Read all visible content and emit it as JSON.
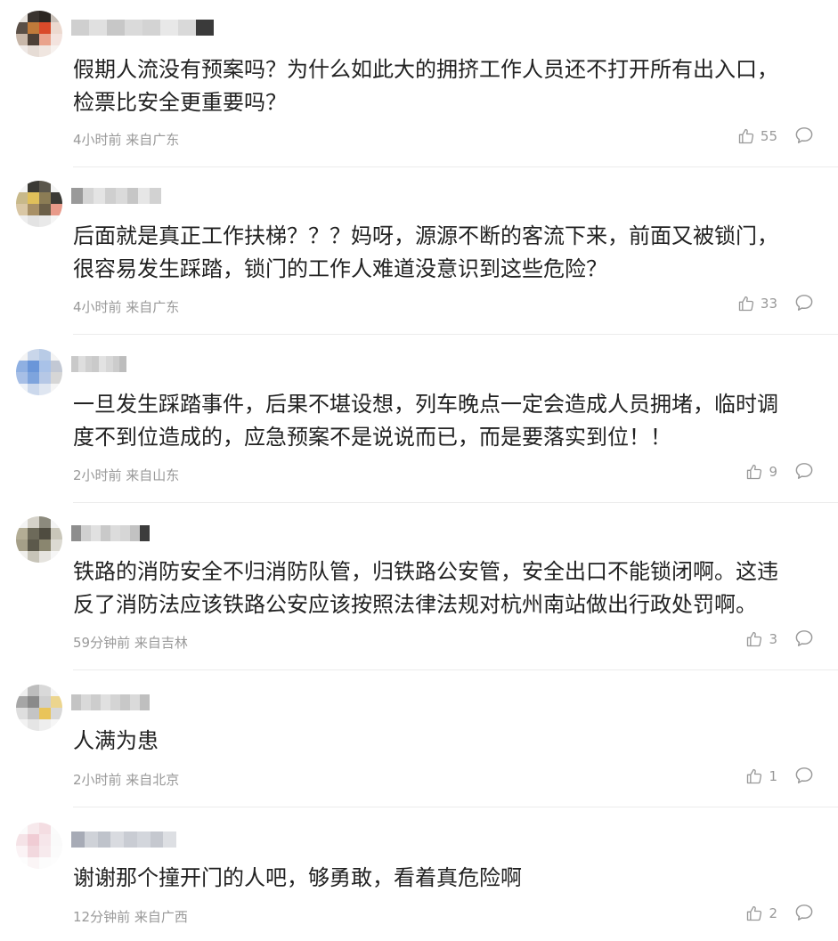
{
  "comments": [
    {
      "text_lines": [
        "假期人流没有预案吗？为什么如此大的拥挤工作人员还不打开所有出入口，",
        "检票比安全更重要吗？"
      ],
      "meta": "4小时前 来自广东",
      "likes": "55",
      "avatar_colors": [
        "#e9e4df",
        "#3a3430",
        "#2b2622",
        "#c9c0b8",
        "#5a4f46",
        "#c07a3a",
        "#d94a2a",
        "#ecd9cf",
        "#c8b7a9",
        "#4d4036",
        "#e9a38c",
        "#f3e3de",
        "#efe9e6",
        "#e6dcd5",
        "#f0e6e0",
        "#f7f2ef"
      ],
      "name_colors": [
        "#cfcfcf",
        "#e0e0e0",
        "#c7c7c7",
        "#dadada",
        "#d3d3d3",
        "#e8e8e8",
        "#d9d9d9",
        "#3a3a3a"
      ]
    },
    {
      "text_lines": [
        "后面就是真正工作扶梯？？？妈呀，源源不断的客流下来，前面又被锁门，",
        "很容易发生踩踏，锁门的工作人难道没意识到这些危险？"
      ],
      "meta": "4小时前 来自广东",
      "likes": "33",
      "avatar_colors": [
        "#f5f5f5",
        "#3b3a35",
        "#5a564c",
        "#f4f4f4",
        "#c8b98a",
        "#e0c05a",
        "#8b7c55",
        "#3b3a35",
        "#d9c7a5",
        "#a89066",
        "#6b5f48",
        "#e89a8a",
        "#eeeeee",
        "#e3e3e3",
        "#e9e9e9",
        "#f5f5f5"
      ],
      "name_colors": [
        "#9a9a9a",
        "#d5d5d5",
        "#e4e4e4",
        "#cfcfcf",
        "#dadada",
        "#c6c6c6",
        "#e6e6e6",
        "#d2d2d2"
      ]
    },
    {
      "text_lines": [
        "一旦发生踩踏事件，后果不堪设想，列车晚点一定会造成人员拥堵，临时调",
        "度不到位造成的，应急预案不是说说而已，而是要落实到位！！"
      ],
      "meta": "2小时前 来自山东",
      "likes": "9",
      "avatar_colors": [
        "#f4f4f4",
        "#c9d6ea",
        "#b8cbe6",
        "#f4f4f4",
        "#8fb0e2",
        "#6a96d9",
        "#a9c2e8",
        "#c2c8d4",
        "#a7bfe6",
        "#7ea4dd",
        "#b6c8e6",
        "#d6d6d6",
        "#eef2f8",
        "#cbd8ec",
        "#dfe6f1",
        "#f5f5f5"
      ],
      "name_colors": [
        "#c9c9c9",
        "#dedede",
        "#d0d0d0",
        "#cacaca",
        "#e2e2e2",
        "#d7d7d7",
        "#cccccc",
        "#bdbdbd"
      ]
    },
    {
      "text_lines": [
        "铁路的消防安全不归消防队管，归铁路公安管，安全出口不能锁闭啊。这违",
        "反了消防法应该铁路公安应该按照法律法规对杭州南站做出行政处罚啊。"
      ],
      "meta": "59分钟前 来自吉林",
      "likes": "3",
      "avatar_colors": [
        "#f4f4f4",
        "#d5d2c9",
        "#8c8a7d",
        "#f4f4f4",
        "#b3ad95",
        "#6d6a5a",
        "#4f4c40",
        "#c9c6b9",
        "#a59f88",
        "#5c594b",
        "#8a866f",
        "#dcdad2",
        "#f0efec",
        "#c7c4b8",
        "#e6e4df",
        "#f6f6f6"
      ],
      "name_colors": [
        "#8e8e8e",
        "#d0d0d0",
        "#e1e1e1",
        "#c9c9c9",
        "#dcdcdc",
        "#d6d6d6",
        "#c2c2c2",
        "#3c3c3c"
      ]
    },
    {
      "text_lines": [
        "人满为患"
      ],
      "meta": "2小时前 来自北京",
      "likes": "1",
      "avatar_colors": [
        "#efefef",
        "#bdbdbd",
        "#d9d9d9",
        "#f4f4f4",
        "#a6a6a6",
        "#8a8a8a",
        "#cfcfcf",
        "#ecd58e",
        "#dedede",
        "#c4c4c4",
        "#e9c45a",
        "#d8d8d8",
        "#f2f2f2",
        "#e5e5e5",
        "#eeeeee",
        "#f6f6f6"
      ],
      "name_colors": [
        "#c4c4c4",
        "#d9d9d9",
        "#cdcdcd",
        "#e0e0e0",
        "#d4d4d4",
        "#c8c8c8",
        "#dadada",
        "#bfbfbf"
      ]
    },
    {
      "text_lines": [
        "谢谢那个撞开门的人吧，够勇敢，看着真危险啊"
      ],
      "meta": "12分钟前 来自广西",
      "likes": "2",
      "avatar_colors": [
        "#fbfbfb",
        "#f7e9ec",
        "#f4dde2",
        "#fbfbfb",
        "#f5e3e7",
        "#f0ccd4",
        "#f6e6ea",
        "#fafafa",
        "#fbf3f5",
        "#f2d8de",
        "#f7eaed",
        "#fbfbfb",
        "#fdfdfd",
        "#fbf5f6",
        "#fcfcfc",
        "#fdfdfd"
      ],
      "name_colors": [
        "#a7abb6",
        "#cfd2d8",
        "#bfc3cb",
        "#d9dbe0",
        "#c9ccd3",
        "#d3d6dc",
        "#c5c8cf",
        "#dddfe3"
      ]
    }
  ]
}
